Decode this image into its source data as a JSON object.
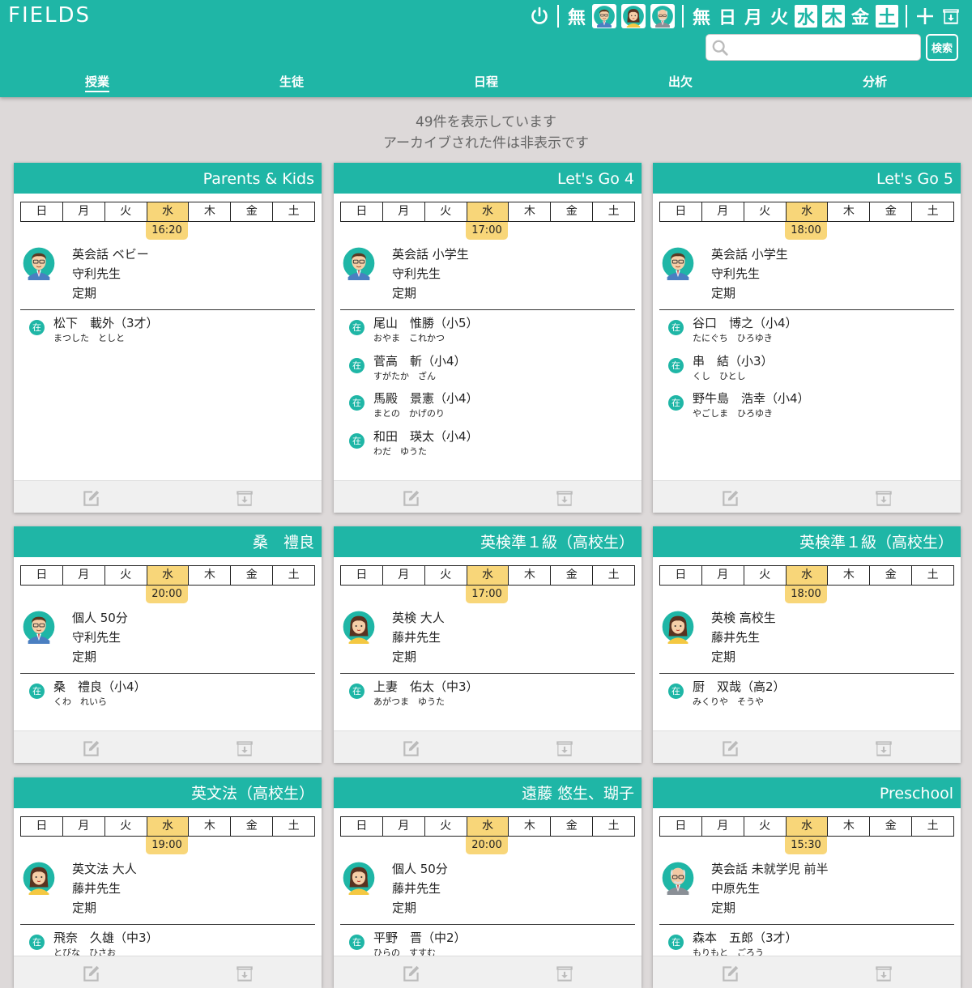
{
  "app": {
    "logo": "FIELDS"
  },
  "toolbar": {
    "power_icon": "power-icon",
    "teacher_none": "無",
    "day_none": "無",
    "days": [
      {
        "label": "日",
        "on": false
      },
      {
        "label": "月",
        "on": false
      },
      {
        "label": "火",
        "on": false
      },
      {
        "label": "水",
        "on": true
      },
      {
        "label": "木",
        "on": true
      },
      {
        "label": "金",
        "on": false
      },
      {
        "label": "土",
        "on": true
      }
    ],
    "add_icon": "plus-icon",
    "archive_icon": "archive-box-icon"
  },
  "search": {
    "placeholder": "",
    "button_label": "検索"
  },
  "nav": {
    "items": [
      "授業",
      "生徒",
      "日程",
      "出欠",
      "分析"
    ],
    "active": 0
  },
  "info": {
    "line1": "49件を表示しています",
    "line2": "アーカイブされた件は非表示です"
  },
  "colors": {
    "accent": "#1fb6a6",
    "highlight": "#f8d679",
    "background": "#ddd9d9"
  },
  "weekday_labels": [
    "日",
    "月",
    "火",
    "水",
    "木",
    "金",
    "土"
  ],
  "cards": [
    {
      "title": "Parents & Kids",
      "time": "16:20",
      "teacher_icon": "male-teacher-avatar",
      "course": "英会話 ベビー",
      "teacher": "守利先生",
      "type": "定期",
      "students": [
        {
          "badge": "在",
          "name": "松下　載外（3才）",
          "kana": "まつした　としと"
        }
      ]
    },
    {
      "title": "Let's Go 4",
      "time": "17:00",
      "teacher_icon": "male-teacher-avatar",
      "course": "英会話 小学生",
      "teacher": "守利先生",
      "type": "定期",
      "students": [
        {
          "badge": "在",
          "name": "尾山　惟勝（小5）",
          "kana": "おやま　これかつ"
        },
        {
          "badge": "在",
          "name": "菅高　斬（小4）",
          "kana": "すがたか　ざん"
        },
        {
          "badge": "在",
          "name": "馬殿　景憲（小4）",
          "kana": "まとの　かげのり"
        },
        {
          "badge": "在",
          "name": "和田　瑛太（小4）",
          "kana": "わだ　ゆうた"
        }
      ]
    },
    {
      "title": "Let's Go 5",
      "time": "18:00",
      "teacher_icon": "male-teacher-avatar",
      "course": "英会話 小学生",
      "teacher": "守利先生",
      "type": "定期",
      "students": [
        {
          "badge": "在",
          "name": "谷口　博之（小4）",
          "kana": "たにぐち　ひろゆき"
        },
        {
          "badge": "在",
          "name": "串　結（小3）",
          "kana": "くし　ひとし"
        },
        {
          "badge": "在",
          "name": "野牛島　浩幸（小4）",
          "kana": "やごしま　ひろゆき"
        }
      ]
    },
    {
      "title": "桑　禮良",
      "time": "20:00",
      "teacher_icon": "male-teacher-avatar",
      "course": "個人 50分",
      "teacher": "守利先生",
      "type": "定期",
      "students": [
        {
          "badge": "在",
          "name": "桑　禮良（小4）",
          "kana": "くわ　れいら"
        }
      ]
    },
    {
      "title": "英検準１級（高校生）",
      "time": "17:00",
      "teacher_icon": "female-teacher-avatar",
      "course": "英検 大人",
      "teacher": "藤井先生",
      "type": "定期",
      "students": [
        {
          "badge": "在",
          "name": "上妻　佑太（中3）",
          "kana": "あがつま　ゆうた"
        }
      ]
    },
    {
      "title": "英検準１級（高校生）",
      "time": "18:00",
      "teacher_icon": "female-teacher-avatar",
      "course": "英検 高校生",
      "teacher": "藤井先生",
      "type": "定期",
      "students": [
        {
          "badge": "在",
          "name": "厨　双哉（高2）",
          "kana": "みくりや　そうや"
        }
      ]
    },
    {
      "title": "英文法（高校生）",
      "time": "19:00",
      "teacher_icon": "female-teacher-avatar",
      "course": "英文法 大人",
      "teacher": "藤井先生",
      "type": "定期",
      "students": [
        {
          "badge": "在",
          "name": "飛奈　久雄（中3）",
          "kana": "とびな　ひさお"
        }
      ]
    },
    {
      "title": "遠藤 悠生、瑚子",
      "time": "20:00",
      "teacher_icon": "female-teacher-avatar",
      "course": "個人 50分",
      "teacher": "藤井先生",
      "type": "定期",
      "students": [
        {
          "badge": "在",
          "name": "平野　晋（中2）",
          "kana": "ひらの　すすむ"
        }
      ]
    },
    {
      "title": "Preschool",
      "time": "15:30",
      "teacher_icon": "elder-teacher-avatar",
      "course": "英会話 未就学児 前半",
      "teacher": "中原先生",
      "type": "定期",
      "students": [
        {
          "badge": "在",
          "name": "森本　五郎（3才）",
          "kana": "もりもと　ごろう"
        }
      ]
    }
  ]
}
